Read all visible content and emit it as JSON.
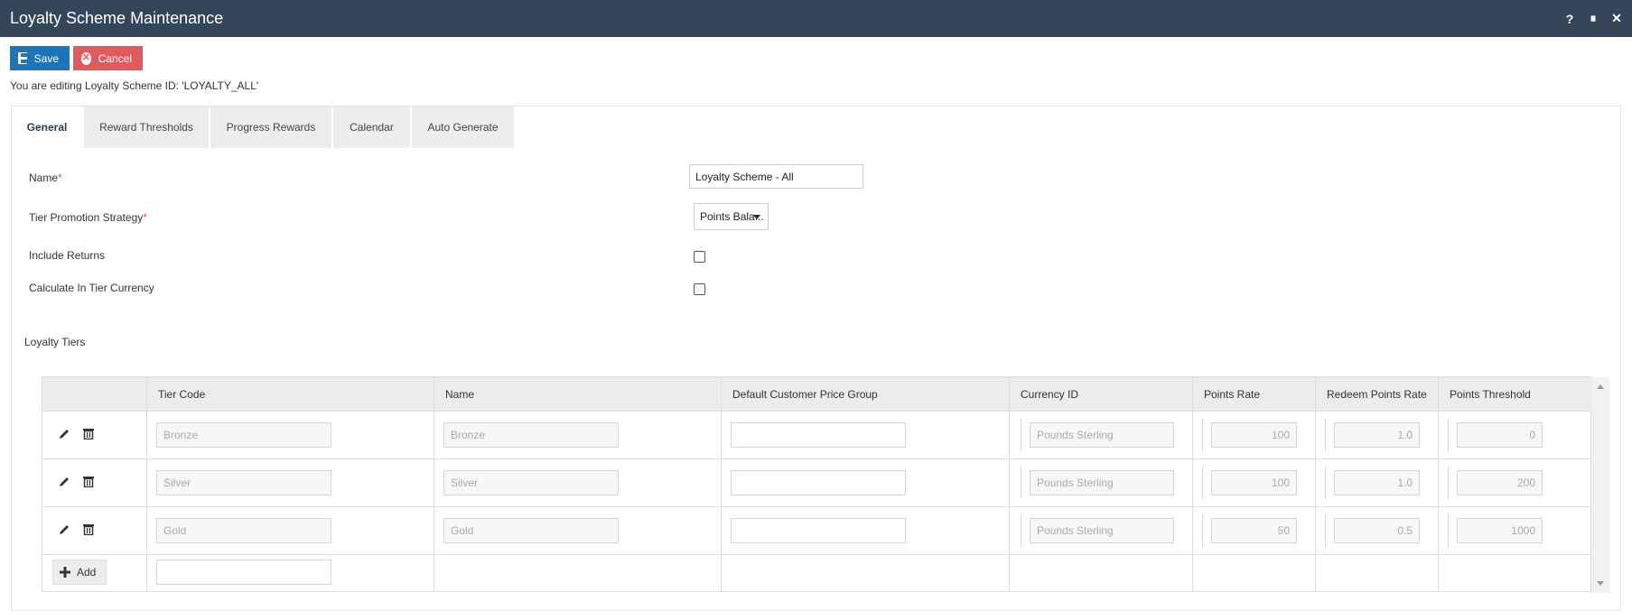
{
  "window": {
    "title": "Loyalty Scheme Maintenance",
    "controls": {
      "help": "?",
      "pause": "⏸",
      "close": "✕"
    }
  },
  "toolbar": {
    "save_label": "Save",
    "cancel_label": "Cancel"
  },
  "editing_text": "You are editing Loyalty Scheme ID: 'LOYALTY_ALL'",
  "tabs": [
    {
      "label": "General",
      "active": true
    },
    {
      "label": "Reward Thresholds",
      "active": false
    },
    {
      "label": "Progress Rewards",
      "active": false
    },
    {
      "label": "Calendar",
      "active": false
    },
    {
      "label": "Auto Generate",
      "active": false
    }
  ],
  "form": {
    "name_label": "Name",
    "name_value": "Loyalty Scheme - All",
    "tier_strategy_label": "Tier Promotion Strategy",
    "tier_strategy_value": "Points Bala...",
    "include_returns_label": "Include Returns",
    "include_returns_checked": false,
    "calc_currency_label": "Calculate In Tier Currency",
    "calc_currency_checked": false,
    "required_marker": "*"
  },
  "loyalty_tiers": {
    "title": "Loyalty Tiers",
    "columns": [
      "Tier Code",
      "Name",
      "Default Customer Price Group",
      "Currency ID",
      "Points Rate",
      "Redeem Points Rate",
      "Points Threshold"
    ],
    "rows": [
      {
        "tier_code": "Bronze",
        "name": "Bronze",
        "price_group": "",
        "currency": "Pounds Sterling",
        "points_rate": "100",
        "redeem_rate": "1.0",
        "threshold": "0"
      },
      {
        "tier_code": "Silver",
        "name": "Silver",
        "price_group": "",
        "currency": "Pounds Sterling",
        "points_rate": "100",
        "redeem_rate": "1.0",
        "threshold": "200"
      },
      {
        "tier_code": "Gold",
        "name": "Gold",
        "price_group": "",
        "currency": "Pounds Sterling",
        "points_rate": "50",
        "redeem_rate": "0.5",
        "threshold": "1000"
      }
    ],
    "add_label": "Add"
  },
  "colors": {
    "titlebar": "#36465a",
    "save": "#1e74b8",
    "cancel": "#e05a5e",
    "required": "#d9534f"
  }
}
